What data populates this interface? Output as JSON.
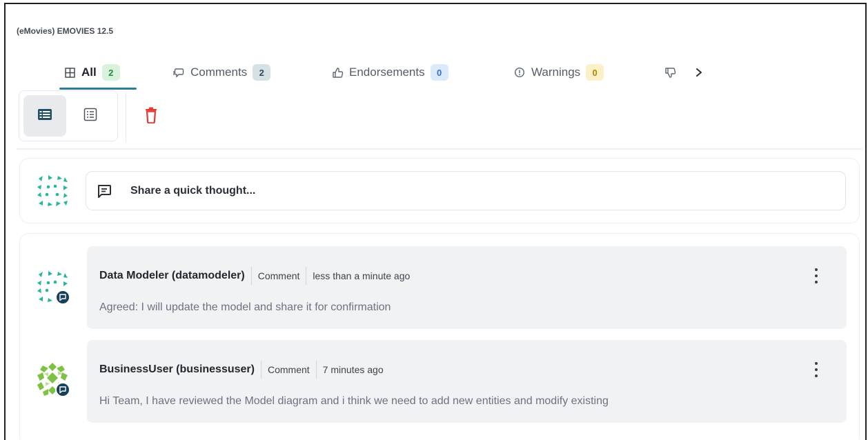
{
  "header": {
    "title": "(eMovies) EMOVIES 12.5"
  },
  "tabs": [
    {
      "label": "All",
      "count": "2",
      "icon": "grid-icon",
      "badge_color": "#d9f2dc"
    },
    {
      "label": "Comments",
      "count": "2",
      "icon": "comment-icon",
      "badge_color": "#d6e1e6"
    },
    {
      "label": "Endorsements",
      "count": "0",
      "icon": "thumbs-up-icon",
      "badge_color": "#dbe9fb"
    },
    {
      "label": "Warnings",
      "count": "0",
      "icon": "warning-circle-icon",
      "badge_color": "#fbf0c6"
    },
    {
      "label": "",
      "icon": "thumbs-down-icon"
    }
  ],
  "toolbar": {
    "buttons": [
      "expanded-view-icon",
      "compact-view-icon",
      "delete-icon"
    ],
    "delete_color": "#e53935"
  },
  "composer": {
    "placeholder": "Share a quick thought..."
  },
  "comments": [
    {
      "author": "Data Modeler (datamodeler)",
      "type": "Comment",
      "time": "less than a minute ago",
      "text": "Agreed: I will update the model and share it for confirmation"
    },
    {
      "author": "BusinessUser (businessuser)",
      "type": "Comment",
      "time": "7 minutes ago",
      "text": "Hi Team, I have reviewed the Model diagram and i think we need to add new entities and modify existing"
    }
  ],
  "colors": {
    "accent": "#2e7d9a",
    "avatar_teal": "#26b79a",
    "avatar_green": "#7dc243",
    "status": "#17405a"
  }
}
